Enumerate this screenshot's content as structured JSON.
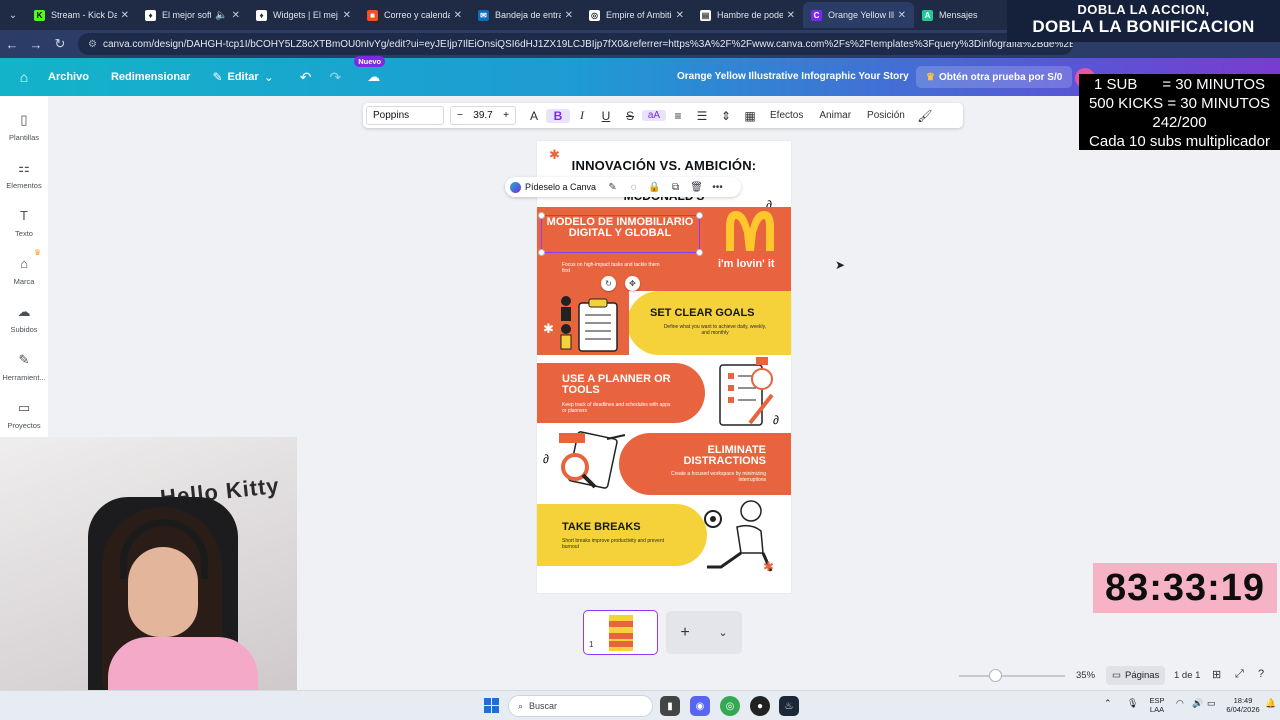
{
  "browser": {
    "tabs": [
      {
        "label": "Stream - Kick Da",
        "fav": "K",
        "color": "#53fc18",
        "fg": "#000"
      },
      {
        "label": "El mejor softw",
        "fav": "♦",
        "color": "#ffffff",
        "fg": "#1f2a44"
      },
      {
        "label": "Widgets | El mej",
        "fav": "♦",
        "color": "#ffffff",
        "fg": "#1f2a44"
      },
      {
        "label": "Correo y calendar",
        "fav": "■",
        "color": "#f25022",
        "fg": "#fff"
      },
      {
        "label": "Bandeja de entrad",
        "fav": "✉",
        "color": "#0f6cbd",
        "fg": "#fff"
      },
      {
        "label": "Empire of Ambitio",
        "fav": "◎",
        "color": "#ffffff",
        "fg": "#333"
      },
      {
        "label": "Hambre de poder",
        "fav": "▤",
        "color": "#ffffff",
        "fg": "#333"
      },
      {
        "label": "Orange Yellow Illu",
        "fav": "C",
        "color": "#7d2ae8",
        "fg": "#fff"
      },
      {
        "label": "Mensajes",
        "fav": "A",
        "color": "#20c997",
        "fg": "#fff"
      }
    ],
    "url": "canva.com/design/DAHGH-tcp1I/bCOHY5LZ8cXTBmOU0nIvYg/edit?ui=eyJEIjp7IlEiOnsiQSI6dHJ1ZX19LCJBIjp7fX0&referrer=https%3A%2F%2Fwww.canva.com%2Fs%2Ftemplates%3Fquery%3Dinfografia%2Bde%2Bmcdonalds"
  },
  "canva": {
    "menu": {
      "file": "Archivo",
      "resize": "Redimensionar",
      "edit": "Editar",
      "new_badge": "Nuevo"
    },
    "doc_title": "Orange Yellow Illustrative Infographic Your Story",
    "trial": "Obtén otra prueba por S/0",
    "sidebar": [
      {
        "label": "Plantillas",
        "icon": "▯"
      },
      {
        "label": "Elementos",
        "icon": "⚏"
      },
      {
        "label": "Texto",
        "icon": "T"
      },
      {
        "label": "Marca",
        "icon": "⌂"
      },
      {
        "label": "Subidos",
        "icon": "☁"
      },
      {
        "label": "Herramient...",
        "icon": "✎"
      },
      {
        "label": "Proyectos",
        "icon": "▭"
      }
    ],
    "toolbar": {
      "font": "Poppins",
      "size": "39.7",
      "effects": "Efectos",
      "animate": "Animar",
      "position": "Posición"
    },
    "floating": {
      "ask": "Pídeselo a Canva"
    },
    "design": {
      "title": "INNOVACIÓN VS. AMBICIÓN:",
      "subtitle": "MCDONALD'S",
      "selected_heading": "MODELO DE INMOBILIARIO DIGITAL Y GLOBAL",
      "selected_desc": "Focus on high-impact tasks and tackle them first",
      "slogan": "i'm lovin' it",
      "goals_h": "SET CLEAR GOALS",
      "goals_d": "Define what you want to achieve daily, weekly, and monthly",
      "planner_h": "USE A PLANNER OR TOOLS",
      "planner_d": "Keep track of deadlines and schedules with apps or planners",
      "distr_h": "ELIMINATE DISTRACTIONS",
      "distr_d": "Create a focused workspace by minimizing interruptions",
      "breaks_h": "TAKE BREAKS",
      "breaks_d": "Short breaks improve productivity and prevent burnout"
    },
    "thumb_number": "1",
    "zoom": "35%",
    "pages_label": "Páginas",
    "page_count": "1 de 1"
  },
  "taskbar": {
    "search": "Buscar",
    "lang_top": "ESP",
    "lang_bottom": "LAA",
    "time": "18:49",
    "date": "6/04/2026"
  },
  "stream": {
    "promo_line1": "DOBLA LA ACCION,",
    "promo_line2": "DOBLA LA BONIFICACION",
    "rules": [
      "1 SUB      = 30 MINUTOS",
      "500 KICKS = 30 MINUTOS",
      "242/200",
      "Cada 10 subs multiplicador"
    ],
    "timer": "83:33:19",
    "poster": "Hello Kitty"
  }
}
